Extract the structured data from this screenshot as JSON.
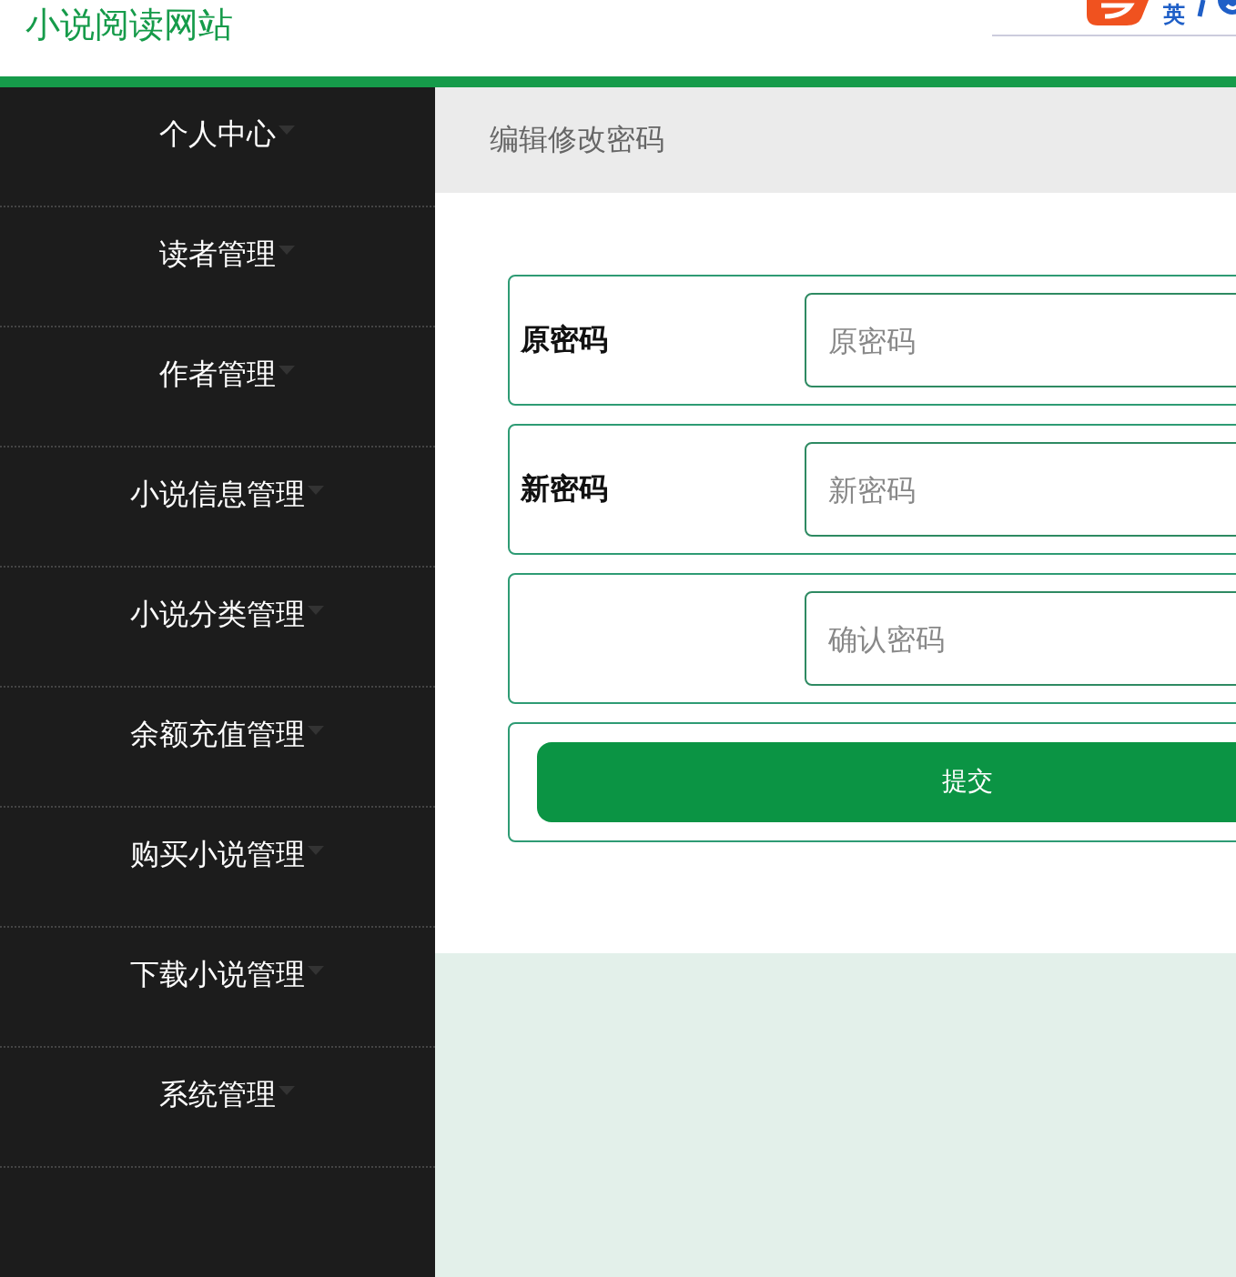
{
  "header": {
    "title": "小说阅读网站",
    "ime_toolbar": {
      "mode": "英"
    }
  },
  "sidebar": {
    "items": [
      {
        "label": "个人中心"
      },
      {
        "label": "读者管理"
      },
      {
        "label": "作者管理"
      },
      {
        "label": "小说信息管理"
      },
      {
        "label": "小说分类管理"
      },
      {
        "label": "余额充值管理"
      },
      {
        "label": "购买小说管理"
      },
      {
        "label": "下载小说管理"
      },
      {
        "label": "系统管理"
      }
    ]
  },
  "breadcrumb": "编辑修改密码",
  "form": {
    "fields": [
      {
        "label": "原密码",
        "placeholder": "原密码"
      },
      {
        "label": "新密码",
        "placeholder": "新密码"
      },
      {
        "placeholder": "确认密码"
      }
    ],
    "submit": "提交"
  }
}
